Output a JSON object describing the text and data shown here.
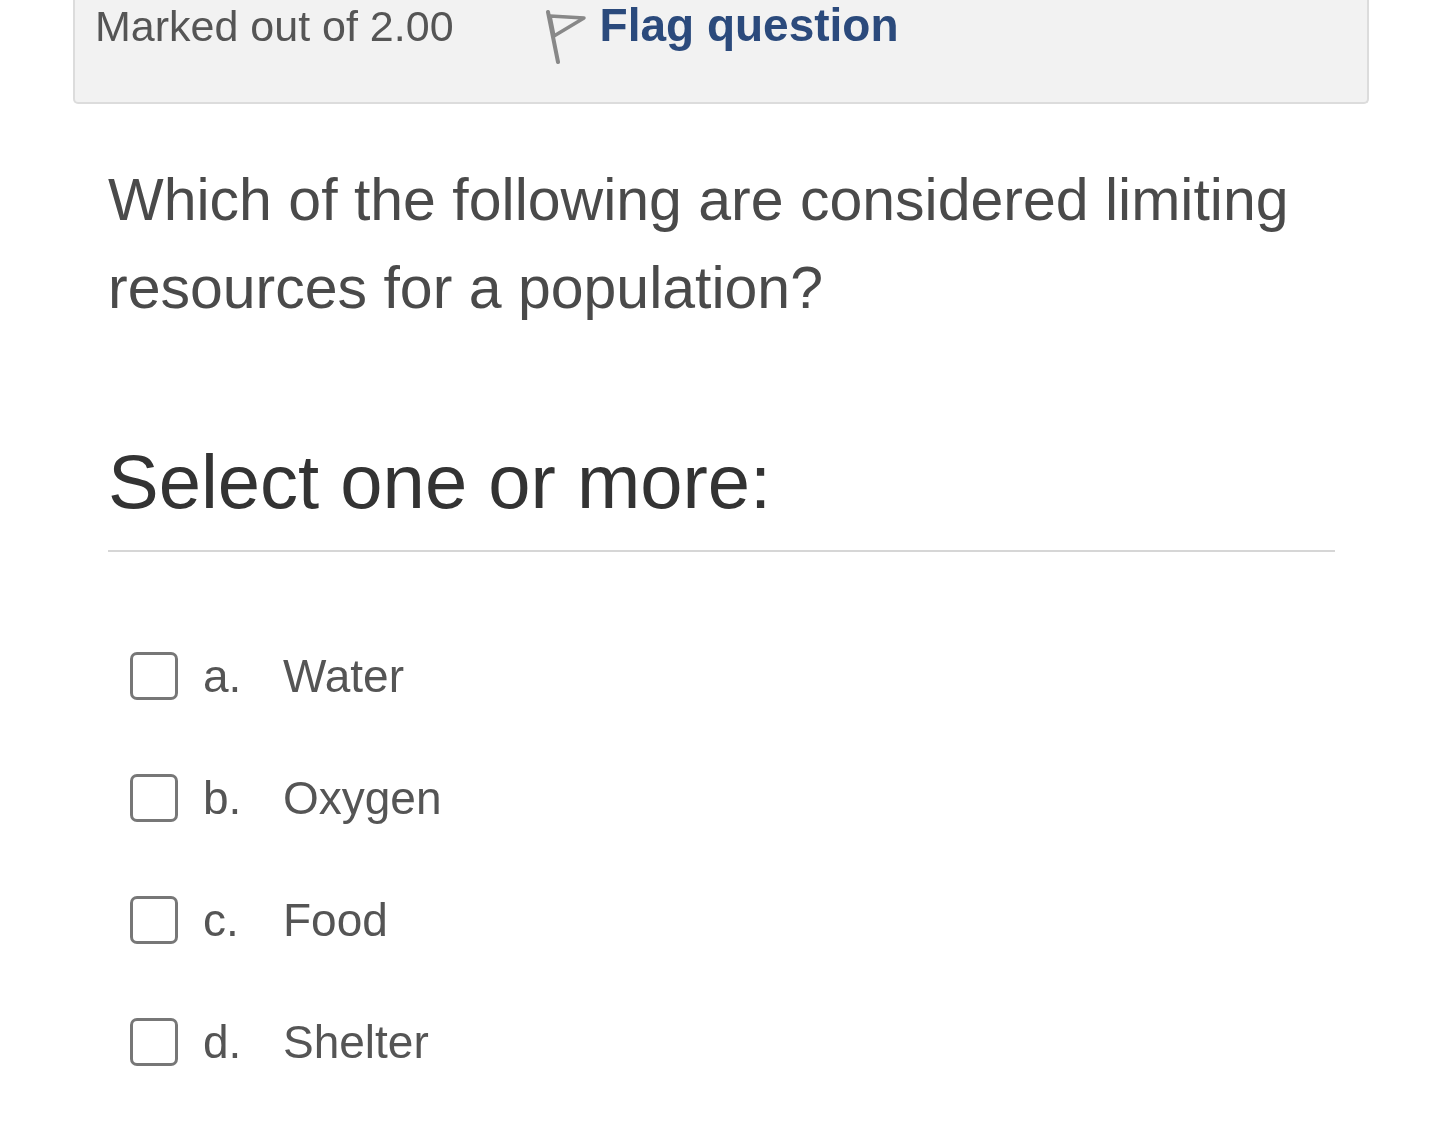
{
  "info": {
    "mark_text": "Marked out of 2.00",
    "flag": {
      "label": "Flag question",
      "flagged": false
    }
  },
  "question": {
    "text": "Which of the following are considered limiting resources for a population?"
  },
  "prompt": "Select one or more:",
  "options": [
    {
      "letter": "a.",
      "label": "Water",
      "checked": false
    },
    {
      "letter": "b.",
      "label": "Oxygen",
      "checked": false
    },
    {
      "letter": "c.",
      "label": "Food",
      "checked": false
    },
    {
      "letter": "d.",
      "label": "Shelter",
      "checked": false
    }
  ]
}
